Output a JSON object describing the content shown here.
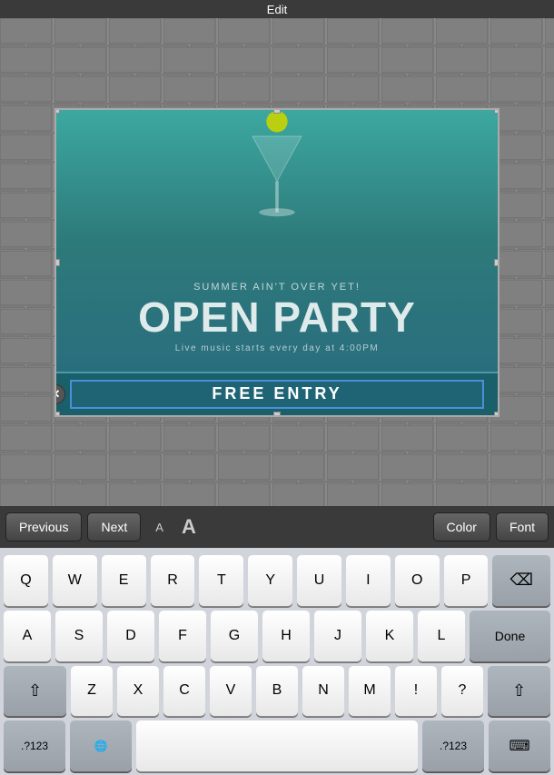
{
  "header": {
    "title": "Edit"
  },
  "poster": {
    "summer_text": "SUMMER AIN'T OVER YET!",
    "open_party_text": "OPEN PARTY",
    "live_music_text": "Live music starts every day at 4:00PM",
    "free_entry_text": "FREE ENTRY"
  },
  "toolbar": {
    "previous_label": "Previous",
    "next_label": "Next",
    "color_label": "Color",
    "font_label": "Font",
    "font_small_label": "A",
    "font_large_label": "A"
  },
  "keyboard": {
    "rows": [
      [
        "Q",
        "W",
        "E",
        "R",
        "T",
        "Y",
        "U",
        "I",
        "O",
        "P"
      ],
      [
        "A",
        "S",
        "D",
        "F",
        "G",
        "H",
        "J",
        "K",
        "L"
      ],
      [
        "Z",
        "X",
        "C",
        "V",
        "B",
        "N",
        "M",
        "!",
        "?"
      ]
    ],
    "bottom_row": [
      ".?123",
      "🌐",
      ".?123",
      "⌨"
    ],
    "done_label": "Done"
  }
}
